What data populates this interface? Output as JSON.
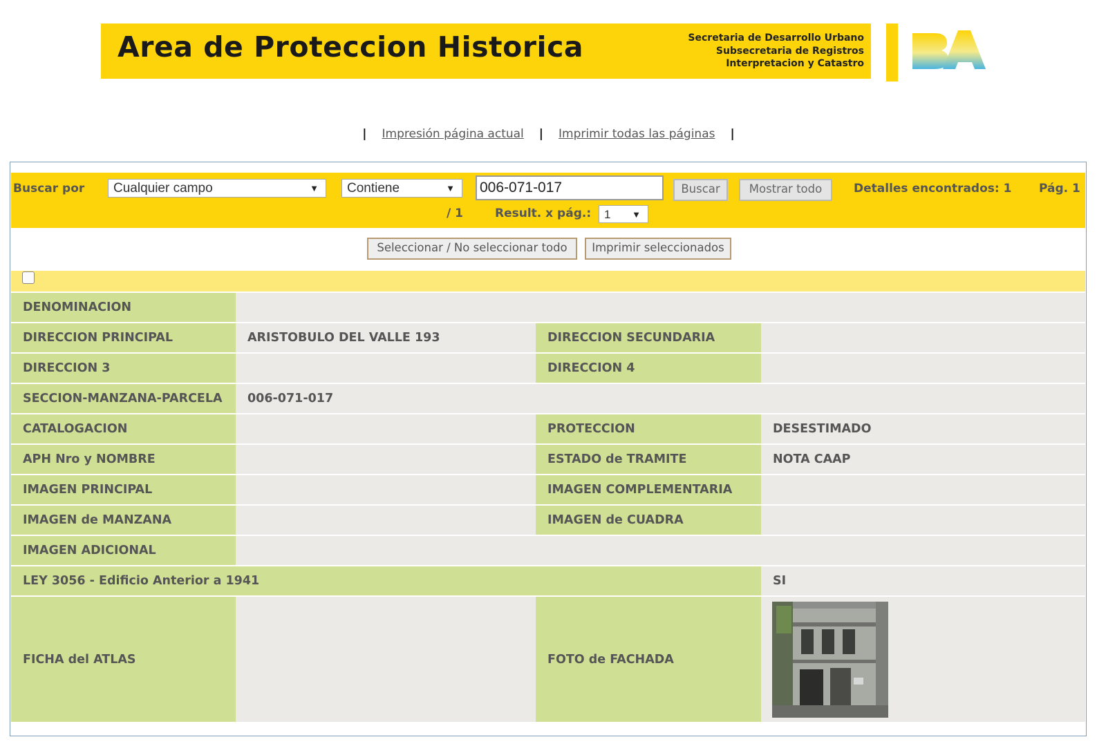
{
  "header": {
    "title": "Area de Proteccion Historica",
    "org_lines": [
      "Secretaria de Desarrollo Urbano",
      "Subsecretaria de Registros",
      "Interpretacion y Catastro"
    ],
    "logo_text": "BA"
  },
  "print_links": {
    "separator": "|",
    "current_page": "Impresión página actual",
    "all_pages": "Imprimir todas las páginas"
  },
  "search": {
    "label": "Buscar por",
    "field_select": "Cualquier campo",
    "operator_select": "Contiene",
    "query": "006-071-017",
    "search_button": "Buscar",
    "show_all_button": "Mostrar todo",
    "details_found": "Detalles encontrados: 1",
    "page_prefix": "Pág. 1",
    "page_suffix": "/ 1",
    "per_page_label": "Result. x pág.:",
    "per_page_value": "1"
  },
  "actions": {
    "select_toggle": "Seleccionar / No seleccionar todo",
    "print_selected": "Imprimir seleccionados"
  },
  "record": {
    "denominacion_label": "DENOMINACION",
    "denominacion_value": "",
    "dir_principal_label": "DIRECCION PRINCIPAL",
    "dir_principal_value": "ARISTOBULO DEL VALLE 193",
    "dir_secundaria_label": "DIRECCION SECUNDARIA",
    "dir_secundaria_value": "",
    "dir3_label": "DIRECCION 3",
    "dir3_value": "",
    "dir4_label": "DIRECCION 4",
    "dir4_value": "",
    "smp_label": "SECCION-MANZANA-PARCELA",
    "smp_value": "006-071-017",
    "catalogacion_label": "CATALOGACION",
    "catalogacion_value": "",
    "proteccion_label": "PROTECCION",
    "proteccion_value": "DESESTIMADO",
    "aph_label": "APH Nro y NOMBRE",
    "aph_value": "",
    "estado_label": "ESTADO de TRAMITE",
    "estado_value": "NOTA CAAP",
    "img_principal_label": "IMAGEN PRINCIPAL",
    "img_principal_value": "",
    "img_complementaria_label": "IMAGEN COMPLEMENTARIA",
    "img_complementaria_value": "",
    "img_manzana_label": "IMAGEN de MANZANA",
    "img_manzana_value": "",
    "img_cuadra_label": "IMAGEN de CUADRA",
    "img_cuadra_value": "",
    "img_adicional_label": "IMAGEN ADICIONAL",
    "img_adicional_value": "",
    "ley_label": "LEY 3056 - Edificio Anterior a 1941",
    "ley_value": "SI",
    "ficha_label": "FICHA del ATLAS",
    "ficha_value": "",
    "foto_label": "FOTO de FACHADA"
  },
  "colors": {
    "brand_yellow": "#fdd40a",
    "label_green": "#cfe095",
    "value_gray": "#eceae6"
  }
}
